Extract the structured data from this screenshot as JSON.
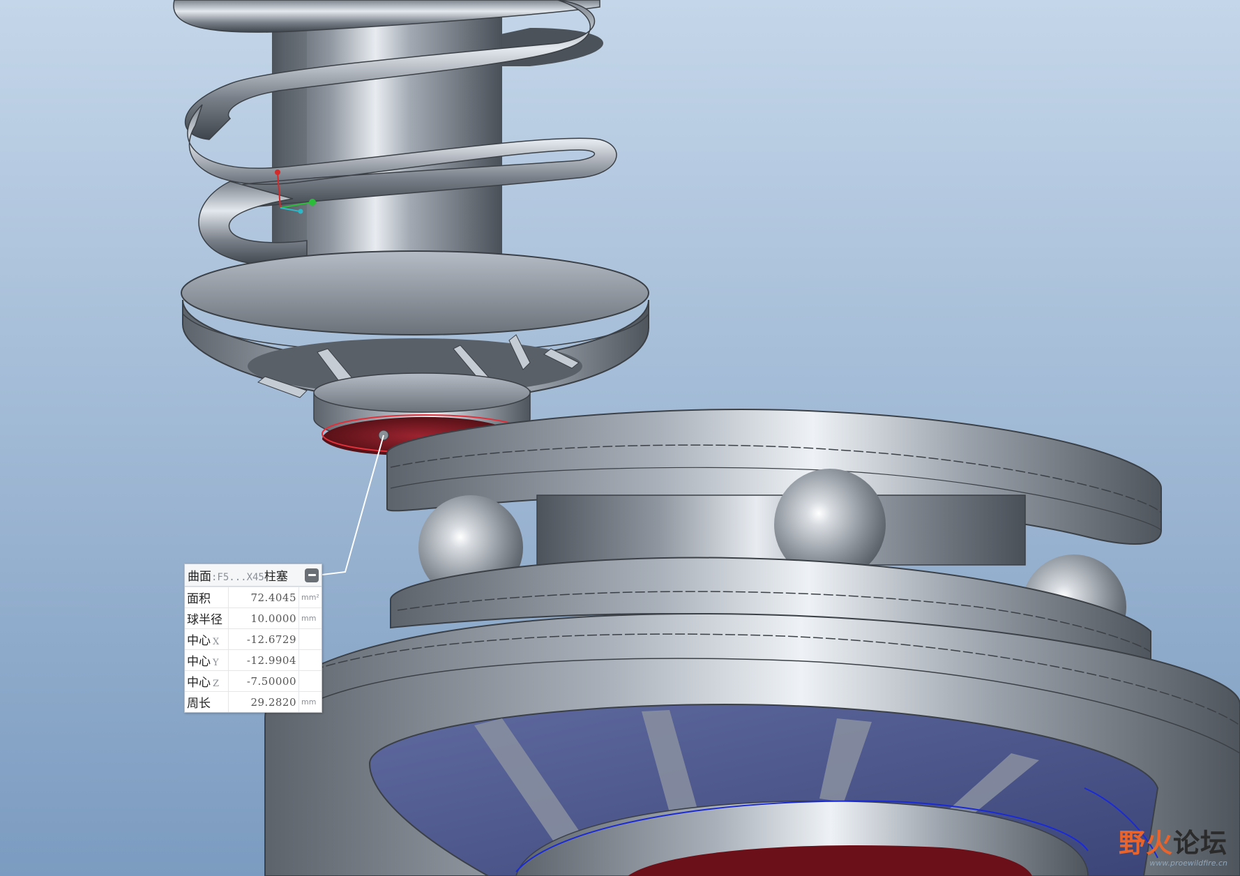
{
  "viewport": {
    "background_top": "#bfd2e6",
    "background_bottom": "#7f9dc0",
    "model_metal": "#8e959e",
    "highlight_edge": "#e0303a",
    "measure_edge": "#1a2bd6"
  },
  "measure_panel": {
    "title_prefix": "曲面",
    "title_ref": ":F5...X45",
    "title_suffix": "柱塞",
    "collapse_icon": "minus-icon",
    "rows": [
      {
        "label": "面积",
        "axis": "",
        "value": "72.4045",
        "unit": "mm²"
      },
      {
        "label": "球半径",
        "axis": "",
        "value": "10.0000",
        "unit": "mm"
      },
      {
        "label": "中心",
        "axis": "X",
        "value": "-12.6729",
        "unit": ""
      },
      {
        "label": "中心",
        "axis": "Y",
        "value": "-12.9904",
        "unit": ""
      },
      {
        "label": "中心",
        "axis": "Z",
        "value": "-7.50000",
        "unit": ""
      },
      {
        "label": "周长",
        "axis": "",
        "value": "29.2820",
        "unit": "mm"
      }
    ]
  },
  "watermark": {
    "text_a": "野火",
    "text_b": "论坛",
    "url": "www.proewildfire.cn"
  }
}
